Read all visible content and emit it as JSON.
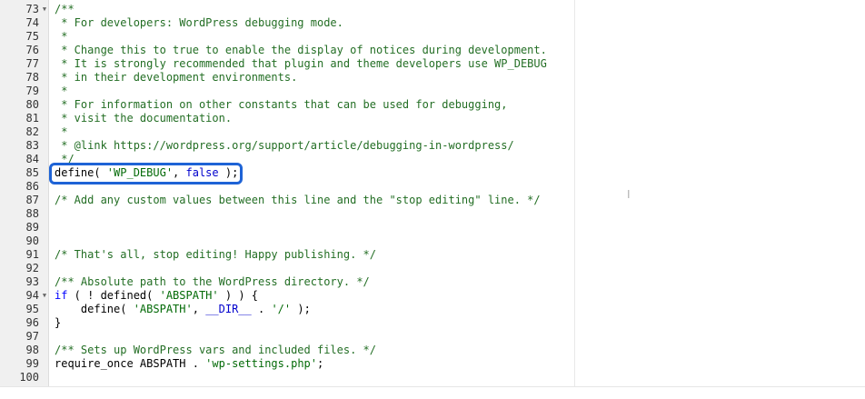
{
  "editor": {
    "lines": [
      {
        "n": "73",
        "fold": true,
        "tokens": [
          {
            "t": "/**",
            "c": "comment"
          }
        ]
      },
      {
        "n": "74",
        "tokens": [
          {
            "t": " * For developers: WordPress debugging mode.",
            "c": "comment"
          }
        ]
      },
      {
        "n": "75",
        "tokens": [
          {
            "t": " *",
            "c": "comment"
          }
        ]
      },
      {
        "n": "76",
        "tokens": [
          {
            "t": " * Change this to true to enable the display of notices during development.",
            "c": "comment"
          }
        ]
      },
      {
        "n": "77",
        "tokens": [
          {
            "t": " * It is strongly recommended that plugin and theme developers use WP_DEBUG",
            "c": "comment"
          }
        ]
      },
      {
        "n": "78",
        "tokens": [
          {
            "t": " * in their development environments.",
            "c": "comment"
          }
        ]
      },
      {
        "n": "79",
        "tokens": [
          {
            "t": " *",
            "c": "comment"
          }
        ]
      },
      {
        "n": "80",
        "tokens": [
          {
            "t": " * For information on other constants that can be used for debugging,",
            "c": "comment"
          }
        ]
      },
      {
        "n": "81",
        "tokens": [
          {
            "t": " * visit the documentation.",
            "c": "comment"
          }
        ]
      },
      {
        "n": "82",
        "tokens": [
          {
            "t": " *",
            "c": "comment"
          }
        ]
      },
      {
        "n": "83",
        "tokens": [
          {
            "t": " * @link https://wordpress.org/support/article/debugging-in-wordpress/",
            "c": "link"
          }
        ]
      },
      {
        "n": "84",
        "tokens": [
          {
            "t": " */",
            "c": "comment"
          }
        ]
      },
      {
        "n": "85",
        "tokens": [
          {
            "t": "define( ",
            "c": "plain"
          },
          {
            "t": "'WP_DEBUG'",
            "c": "string"
          },
          {
            "t": ", ",
            "c": "plain"
          },
          {
            "t": "false",
            "c": "const"
          },
          {
            "t": " );",
            "c": "plain"
          }
        ]
      },
      {
        "n": "86",
        "tokens": []
      },
      {
        "n": "87",
        "tokens": [
          {
            "t": "/* Add any custom values between this line and the \"stop editing\" line. */",
            "c": "comment"
          }
        ]
      },
      {
        "n": "88",
        "tokens": []
      },
      {
        "n": "89",
        "tokens": []
      },
      {
        "n": "90",
        "tokens": []
      },
      {
        "n": "91",
        "tokens": [
          {
            "t": "/* That's all, stop editing! Happy publishing. */",
            "c": "comment"
          }
        ]
      },
      {
        "n": "92",
        "tokens": []
      },
      {
        "n": "93",
        "tokens": [
          {
            "t": "/** Absolute path to the WordPress directory. */",
            "c": "comment"
          }
        ]
      },
      {
        "n": "94",
        "fold": true,
        "tokens": [
          {
            "t": "if",
            "c": "keyword"
          },
          {
            "t": " ( ! defined( ",
            "c": "plain"
          },
          {
            "t": "'ABSPATH'",
            "c": "string"
          },
          {
            "t": " ) ) {",
            "c": "plain"
          }
        ]
      },
      {
        "n": "95",
        "tokens": [
          {
            "t": "    define( ",
            "c": "plain"
          },
          {
            "t": "'ABSPATH'",
            "c": "string"
          },
          {
            "t": ", ",
            "c": "plain"
          },
          {
            "t": "__DIR__",
            "c": "const"
          },
          {
            "t": " . ",
            "c": "plain"
          },
          {
            "t": "'/'",
            "c": "string"
          },
          {
            "t": " );",
            "c": "plain"
          }
        ]
      },
      {
        "n": "96",
        "tokens": [
          {
            "t": "}",
            "c": "plain"
          }
        ]
      },
      {
        "n": "97",
        "tokens": []
      },
      {
        "n": "98",
        "tokens": [
          {
            "t": "/** Sets up WordPress vars and included files. */",
            "c": "comment"
          }
        ]
      },
      {
        "n": "99",
        "tokens": [
          {
            "t": "require_once ABSPATH . ",
            "c": "plain"
          },
          {
            "t": "'wp-settings.php'",
            "c": "string"
          },
          {
            "t": ";",
            "c": "plain"
          }
        ]
      },
      {
        "n": "100",
        "tokens": []
      }
    ]
  },
  "highlight": {
    "line": "85",
    "color": "#1e63d6"
  },
  "icons": {
    "fold": "fold-arrow-icon",
    "cursor": "text-cursor-icon"
  }
}
